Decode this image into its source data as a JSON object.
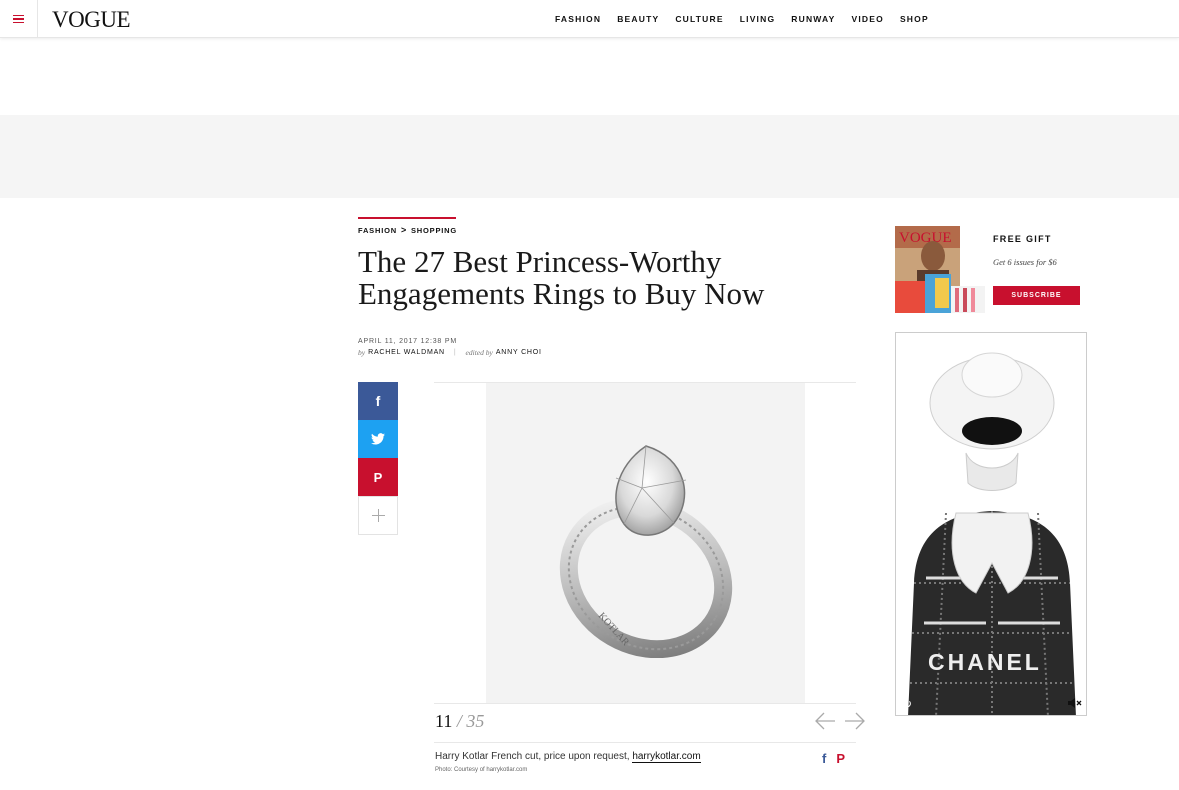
{
  "header": {
    "logo": "VOGUE",
    "nav": [
      "FASHION",
      "BEAUTY",
      "CULTURE",
      "LIVING",
      "RUNWAY",
      "VIDEO",
      "SHOP"
    ]
  },
  "article": {
    "breadcrumb": {
      "section": "FASHION",
      "separator": ">",
      "subsection": "SHOPPING"
    },
    "title": "The 27 Best Princess-Worthy Engagements Rings to Buy Now",
    "date": "APRIL 11, 2017 12:38 PM",
    "by_prefix": "by",
    "author": "RACHEL WALDMAN",
    "pipe": "|",
    "edited_prefix": "edited by",
    "editor": "ANNY CHOI"
  },
  "share": {
    "facebook": "f",
    "pinterest": "P"
  },
  "gallery": {
    "current": "11",
    "slash": "/",
    "total": "35",
    "ring_engraving": "KOTLAR",
    "caption_text": "Harry Kotlar French cut, price upon request, ",
    "caption_link": "harrykotlar.com",
    "credit": "Photo: Courtesy of harrykotlar.com",
    "share_fb": "f",
    "share_pin": "P"
  },
  "sidebar": {
    "magazine_logo": "VOGUE",
    "promo_title": "FREE GIFT",
    "promo_sub": "Get 6 issues for $6",
    "subscribe": "SUBSCRIBE",
    "ad_brand": "CHANEL"
  },
  "colors": {
    "accent": "#c8102e",
    "facebook": "#3b5998",
    "twitter": "#1da1f2"
  }
}
